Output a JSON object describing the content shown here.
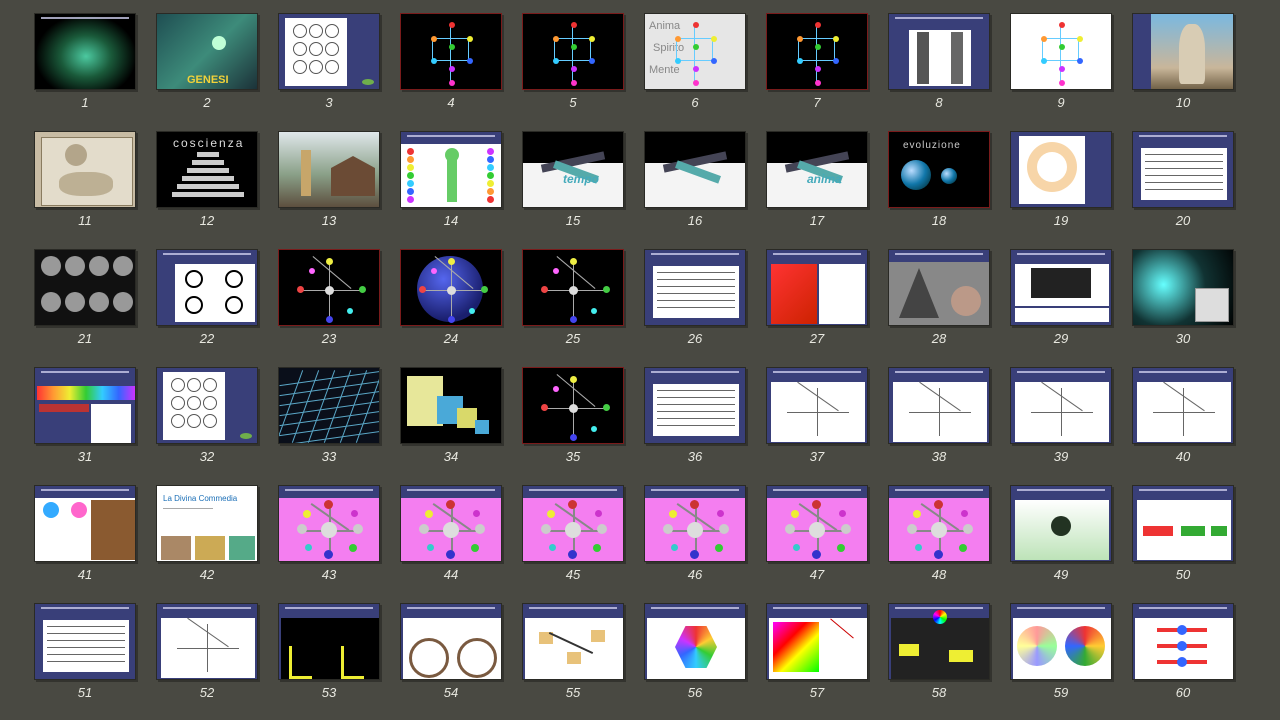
{
  "slides": [
    {
      "number": "1",
      "style": "black"
    },
    {
      "number": "2",
      "style": "teal",
      "text": "GENESI"
    },
    {
      "number": "3",
      "style": "navy-white"
    },
    {
      "number": "4",
      "style": "black-tree"
    },
    {
      "number": "5",
      "style": "black-tree"
    },
    {
      "number": "6",
      "style": "gray-words",
      "words": [
        "Anima",
        "Spirito",
        "Mente"
      ]
    },
    {
      "number": "7",
      "style": "black-tree"
    },
    {
      "number": "8",
      "style": "navy-columns"
    },
    {
      "number": "9",
      "style": "white-tree"
    },
    {
      "number": "10",
      "style": "navy-statue"
    },
    {
      "number": "11",
      "style": "beige"
    },
    {
      "number": "12",
      "style": "black-pyramid",
      "text": "coscienza"
    },
    {
      "number": "13",
      "style": "photo"
    },
    {
      "number": "14",
      "style": "white-chakra"
    },
    {
      "number": "15",
      "style": "3d-white",
      "text": "tempo"
    },
    {
      "number": "16",
      "style": "3d-white"
    },
    {
      "number": "17",
      "style": "3d-white",
      "text": "anima"
    },
    {
      "number": "18",
      "style": "black-sphere",
      "text": "evoluzione"
    },
    {
      "number": "19",
      "style": "navy-circle"
    },
    {
      "number": "20",
      "style": "navy-table"
    },
    {
      "number": "21",
      "style": "crystals"
    },
    {
      "number": "22",
      "style": "navy-symbols"
    },
    {
      "number": "23",
      "style": "black-axes"
    },
    {
      "number": "24",
      "style": "blue-sphere"
    },
    {
      "number": "25",
      "style": "black-axes"
    },
    {
      "number": "26",
      "style": "navy-table"
    },
    {
      "number": "27",
      "style": "red-split"
    },
    {
      "number": "28",
      "style": "navy-shapes"
    },
    {
      "number": "29",
      "style": "navy-mixed"
    },
    {
      "number": "30",
      "style": "teal-cube"
    },
    {
      "number": "31",
      "style": "navy-bars"
    },
    {
      "number": "32",
      "style": "navy-white"
    },
    {
      "number": "33",
      "style": "black-lines"
    },
    {
      "number": "34",
      "style": "black-cubes"
    },
    {
      "number": "35",
      "style": "black-axes"
    },
    {
      "number": "36",
      "style": "navy-table"
    },
    {
      "number": "37",
      "style": "navy-diagram"
    },
    {
      "number": "38",
      "style": "navy-diagram"
    },
    {
      "number": "39",
      "style": "navy-diagram"
    },
    {
      "number": "40",
      "style": "navy-diagram"
    },
    {
      "number": "41",
      "style": "navy-people"
    },
    {
      "number": "42",
      "style": "white-commedia",
      "text": "La Divina Commedia"
    },
    {
      "number": "43",
      "style": "pink"
    },
    {
      "number": "44",
      "style": "pink"
    },
    {
      "number": "45",
      "style": "pink"
    },
    {
      "number": "46",
      "style": "pink"
    },
    {
      "number": "47",
      "style": "pink"
    },
    {
      "number": "48",
      "style": "pink"
    },
    {
      "number": "49",
      "style": "navy-green"
    },
    {
      "number": "50",
      "style": "navy-wave"
    },
    {
      "number": "51",
      "style": "navy-list"
    },
    {
      "number": "52",
      "style": "navy-diagram"
    },
    {
      "number": "53",
      "style": "navy-black"
    },
    {
      "number": "54",
      "style": "navy-knot"
    },
    {
      "number": "55",
      "style": "navy-blocks"
    },
    {
      "number": "56",
      "style": "navy-hexagon"
    },
    {
      "number": "57",
      "style": "navy-colorcube"
    },
    {
      "number": "58",
      "style": "navy-dark3d"
    },
    {
      "number": "59",
      "style": "navy-wheels"
    },
    {
      "number": "60",
      "style": "navy-arrows"
    }
  ]
}
